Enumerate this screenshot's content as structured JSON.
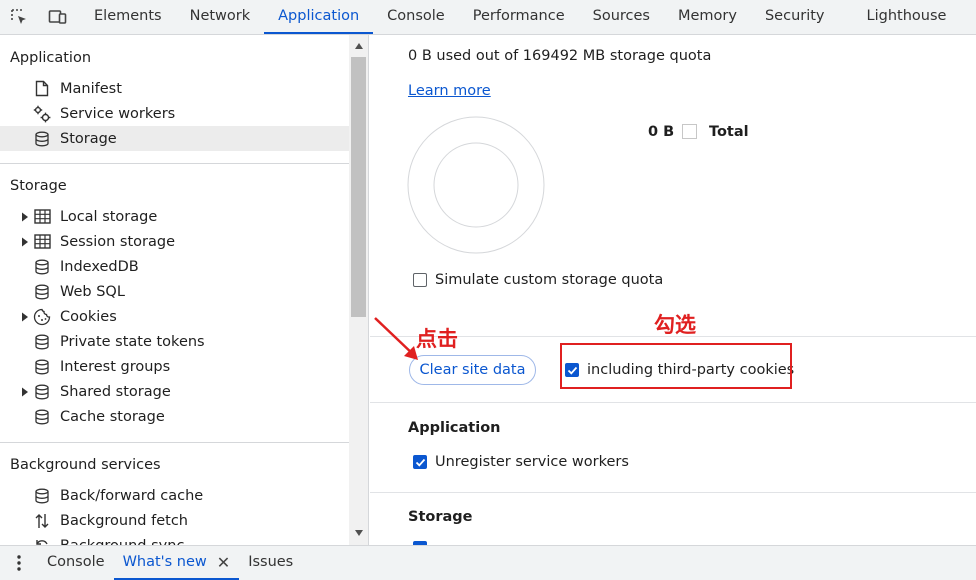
{
  "toolbar": {
    "inspect_icon": "inspect-element-icon",
    "device_icon": "device-toolbar-icon",
    "tabs": [
      "Elements",
      "Network",
      "Application",
      "Console",
      "Performance",
      "Sources",
      "Memory",
      "Security",
      "Lighthouse"
    ],
    "active_tab": "Application"
  },
  "sidebar": {
    "application": {
      "title": "Application",
      "items": [
        {
          "label": "Manifest",
          "icon": "document-icon"
        },
        {
          "label": "Service workers",
          "icon": "gears-icon"
        },
        {
          "label": "Storage",
          "icon": "database-icon",
          "selected": true
        }
      ]
    },
    "storage": {
      "title": "Storage",
      "items": [
        {
          "label": "Local storage",
          "icon": "table-icon",
          "expandable": true
        },
        {
          "label": "Session storage",
          "icon": "table-icon",
          "expandable": true
        },
        {
          "label": "IndexedDB",
          "icon": "database-icon"
        },
        {
          "label": "Web SQL",
          "icon": "database-icon"
        },
        {
          "label": "Cookies",
          "icon": "cookie-icon",
          "expandable": true
        },
        {
          "label": "Private state tokens",
          "icon": "database-icon"
        },
        {
          "label": "Interest groups",
          "icon": "database-icon"
        },
        {
          "label": "Shared storage",
          "icon": "database-icon",
          "expandable": true
        },
        {
          "label": "Cache storage",
          "icon": "database-icon"
        }
      ]
    },
    "background": {
      "title": "Background services",
      "items": [
        {
          "label": "Back/forward cache",
          "icon": "database-icon"
        },
        {
          "label": "Background fetch",
          "icon": "up-down-arrows-icon"
        },
        {
          "label": "Background sync",
          "icon": "sync-icon"
        }
      ]
    }
  },
  "main": {
    "quota_text": "0 B used out of 169492 MB storage quota",
    "learn_more": "Learn more",
    "total_value": "0 B",
    "total_label": "Total",
    "simulate_label": "Simulate custom storage quota",
    "simulate_checked": false,
    "clear_button": "Clear site data",
    "third_party_label": "including third-party cookies",
    "third_party_checked": true,
    "application_heading": "Application",
    "unregister_label": "Unregister service workers",
    "unregister_checked": true,
    "storage_heading": "Storage"
  },
  "annotations": {
    "click_text": "点击",
    "check_text": "勾选",
    "color": "#e02020"
  },
  "drawer": {
    "tabs": [
      "Console",
      "What's new",
      "Issues"
    ],
    "active_tab": "What's new"
  },
  "colors": {
    "accent": "#0b57d0",
    "annotation": "#e02020"
  }
}
